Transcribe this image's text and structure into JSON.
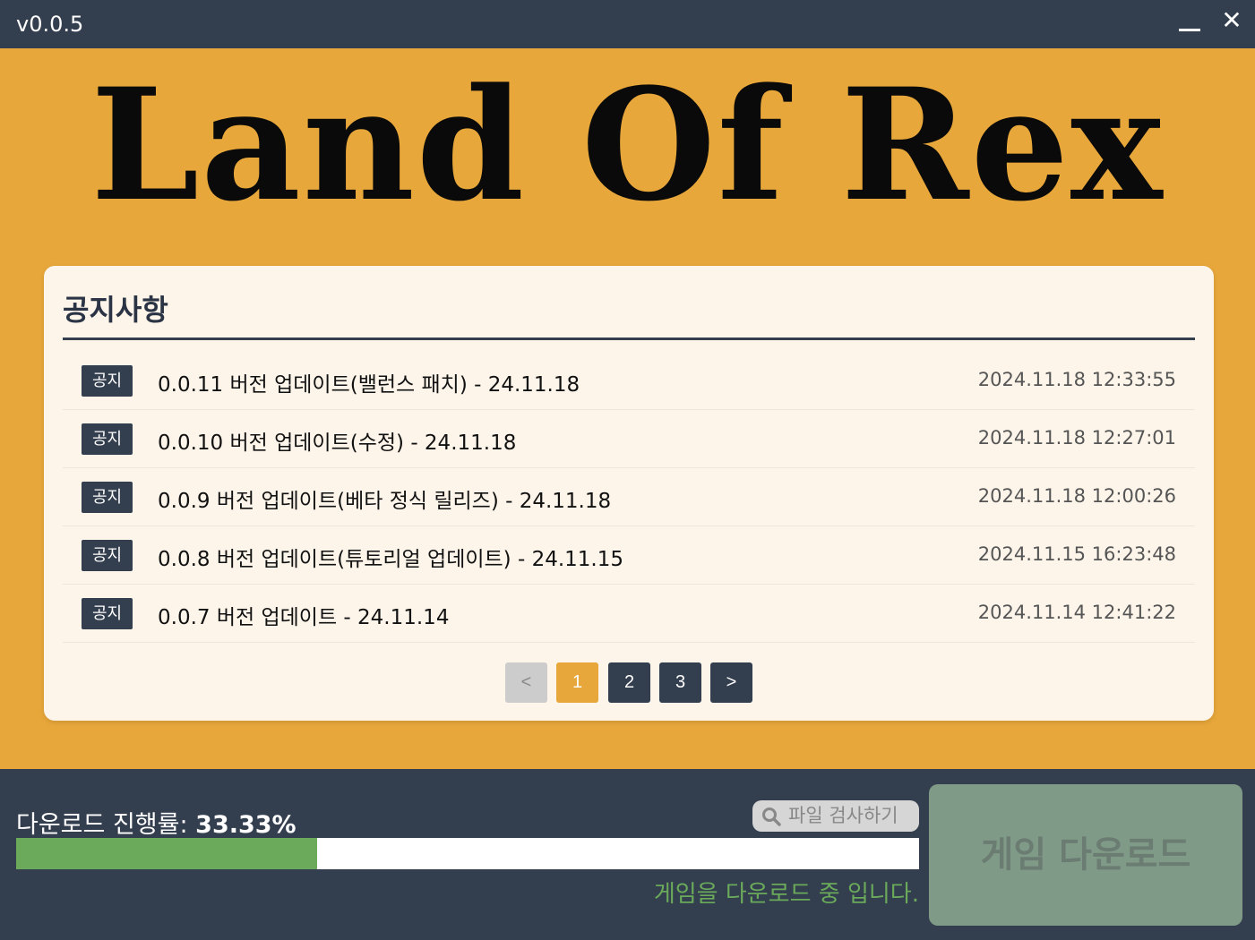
{
  "window": {
    "version": "v0.0.5",
    "minimize_icon": "minimize-icon",
    "close_icon": "close-icon",
    "close_glyph": "✕"
  },
  "hero": {
    "logo": "Land Of Rex"
  },
  "notices": {
    "title": "공지사항",
    "items": [
      {
        "badge": "공지",
        "text": "0.0.11 버전 업데이트(밸런스 패치) - 24.11.18",
        "date": "2024.11.18 12:33:55"
      },
      {
        "badge": "공지",
        "text": "0.0.10 버전 업데이트(수정) - 24.11.18",
        "date": "2024.11.18 12:27:01"
      },
      {
        "badge": "공지",
        "text": "0.0.9 버전 업데이트(베타 정식 릴리즈) - 24.11.18",
        "date": "2024.11.18 12:00:26"
      },
      {
        "badge": "공지",
        "text": "0.0.8 버전 업데이트(튜토리얼 업데이트) - 24.11.15",
        "date": "2024.11.15 16:23:48"
      },
      {
        "badge": "공지",
        "text": "0.0.7 버전 업데이트 - 24.11.14",
        "date": "2024.11.14 12:41:22"
      }
    ],
    "pagination": {
      "prev": "<",
      "pages": [
        "1",
        "2",
        "3"
      ],
      "current": "1",
      "next": ">"
    }
  },
  "footer": {
    "progress_label": "다운로드 진행률: ",
    "progress_value": "33.33%",
    "progress_fraction": 0.3333,
    "scan_button": "파일 검사하기",
    "scan_icon": "search-icon",
    "status_message": "게임을 다운로드 중 입니다.",
    "game_button": "게임 다운로드"
  },
  "colors": {
    "accent": "#e8a73a",
    "dark": "#333e4e",
    "progress": "#6aaa5a",
    "card": "#fdf5ea"
  }
}
